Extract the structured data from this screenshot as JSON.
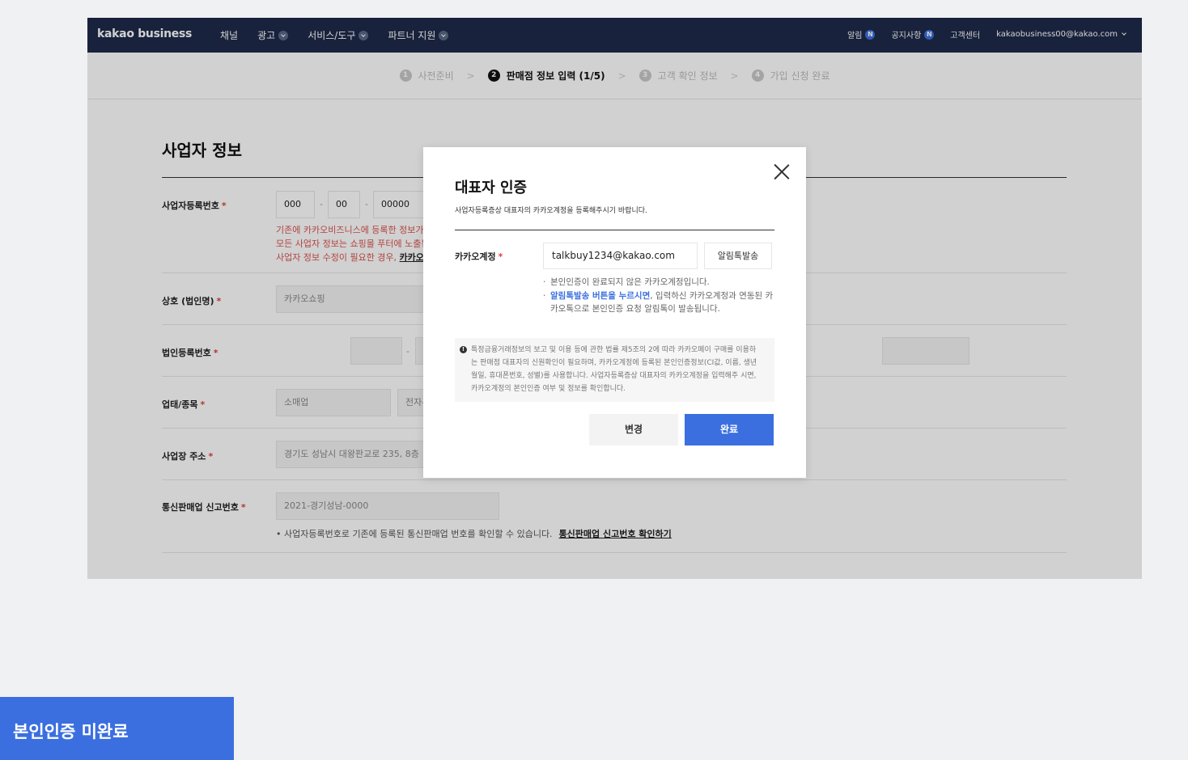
{
  "topnav": {
    "logo": "kakao business",
    "menu": [
      {
        "label": "채널",
        "dropdown": false
      },
      {
        "label": "광고",
        "dropdown": true
      },
      {
        "label": "서비스/도구",
        "dropdown": true
      },
      {
        "label": "파트너 지원",
        "dropdown": true
      }
    ],
    "alarm_label": "알림",
    "notice_label": "공지사항",
    "badge": "N",
    "support_label": "고객센터",
    "account": "kakaobusiness00@kakao.com"
  },
  "stepper": {
    "steps": [
      {
        "num": "1",
        "label": "사전준비"
      },
      {
        "num": "2",
        "label": "판매점 정보 입력 (1/5)"
      },
      {
        "num": "3",
        "label": "고객 확인 정보"
      },
      {
        "num": "4",
        "label": "가입 신청 완료"
      }
    ],
    "separator": ">"
  },
  "form": {
    "title": "사업자 정보",
    "required_mark": "*",
    "bizno": {
      "label": "사업자등록번호",
      "part1": "000",
      "part2": "00",
      "part3": "00000",
      "dash": "-",
      "note_line1": "기존에 카카오비즈니스에 등록한 정보가",
      "note_line2": "모든 사업자 정보는 쇼핑몰 푸터에 노출된",
      "note_line3_prefix": "사업자 정보 수정이 필요한 경우,",
      "note_line3_link": "카카오b"
    },
    "company": {
      "label": "상호 (법인명)",
      "value": "카카오쇼핑"
    },
    "corpno": {
      "label": "법인등록번호",
      "dash": "-"
    },
    "bizcat": {
      "label": "업태/종목",
      "value1": "소매업",
      "value2": "전자-"
    },
    "address": {
      "label": "사업장 주소",
      "value": "경기도 성남시 대왕판교로 235, 8층"
    },
    "ecomm": {
      "label": "통신판매업 신고번호",
      "value": "2021-경기성남-0000",
      "info": "• 사업자등록번호로 기존에 등록된 통신판매업 번호를 확인할 수 있습니다.",
      "info_link": "통신판매업 신고번호 확인하기"
    }
  },
  "modal": {
    "title": "대표자 인증",
    "subtitle": "사업자등록증상 대표자의 카카오계정을 등록해주시기 바랍니다.",
    "account_label": "카카오계정",
    "account_value": "talkbuy1234@kakao.com",
    "send_button": "알림톡발송",
    "note1": "본인인증이 완료되지 않은 카카오계정입니다.",
    "note2_blue": "알림톡발송 버튼을 누르시면",
    "note2_rest": ", 입력하신 카카오계정과 연동된 카카오톡으로 본인인증 요청 알림톡이 발송됩니다.",
    "notice_icon": "!",
    "notice_line1": "특정금융거래정보의 보고 및 이용 등에 관한 법률 제5조의 2에 따라 카카오페이 구매를 이용하",
    "notice_line2": "는 판매점 대표자의 신원확인이 필요하며, 카카오계정에 등록된 본인인증정보(CI값, 이름, 생년",
    "notice_line3": "월일, 휴대폰번호, 성별)를 사용합니다. 사업자등록증상 대표자의 카카오계정을 입력해주 시면,",
    "notice_line4": "카카오계정의 본인인증 여부 및 정보를 확인합니다.",
    "change_button": "변경",
    "done_button": "완료"
  },
  "caption": "본인인증 미완료"
}
